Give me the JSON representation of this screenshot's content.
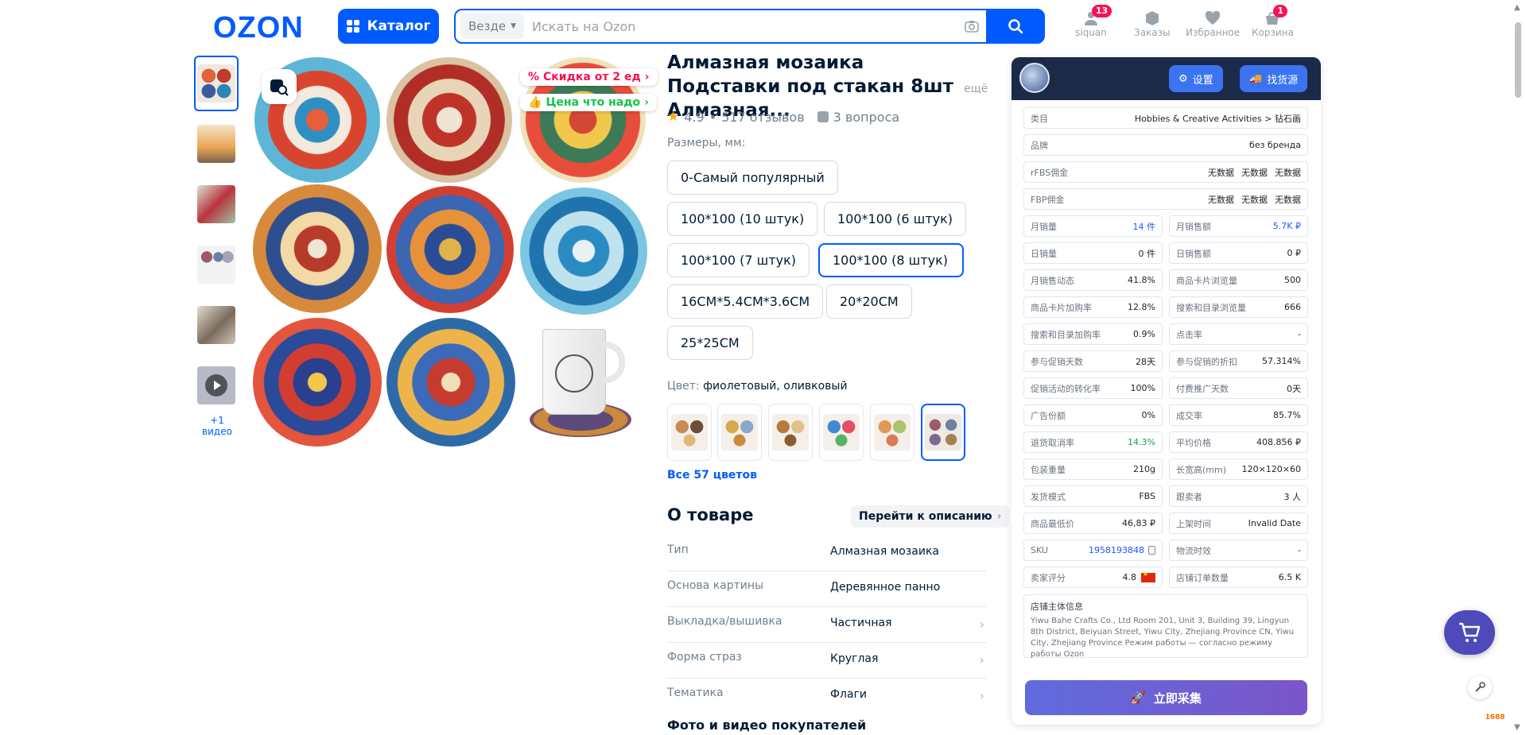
{
  "header": {
    "logo": "OZON",
    "catalog_label": "Каталог",
    "search_scope": "Везде",
    "search_placeholder": "Искать на Ozon",
    "nav": [
      {
        "label": "siquan",
        "badge": "13"
      },
      {
        "label": "Заказы",
        "badge": ""
      },
      {
        "label": "Избранное",
        "badge": ""
      },
      {
        "label": "Корзина",
        "badge": "1"
      }
    ]
  },
  "gallery": {
    "video_label": "+1 видео",
    "stickers": [
      "Скидка от 2 ед",
      "Цена что надо"
    ],
    "colors": {
      "thumb1": "#d84c2f",
      "thumb2": "#e8a552",
      "thumb3": "#c7d3c0",
      "thumb4": "#a8a2b4",
      "thumb5": "#7a6b5c",
      "thumb6": "#9a9fb2"
    }
  },
  "product": {
    "title": "Алмазная мозаика Подставки под стакан 8шт Алмазная...",
    "more": "ещё",
    "rating": "4.9",
    "reviews": "517 отзывов",
    "questions": "3 вопроса",
    "sizes_label": "Размеры, мм:",
    "sizes": [
      "0-Самый популярный",
      "100*100  (10 штук)",
      "100*100  (6 штук)",
      "100*100  (7 штук)",
      "100*100  (8 штук)",
      "16CM*5.4CM*3.6CM",
      "20*20CM",
      "25*25CM"
    ],
    "selected_size": "100*100  (8 штук)",
    "color_label": "Цвет:",
    "color_value": "фиолетовый, оливковый",
    "all_colors": "Все 57 цветов",
    "about_title": "О товаре",
    "to_description": "Перейти к описанию",
    "attributes": [
      {
        "key": "Тип",
        "value": "Алмазная мозаика"
      },
      {
        "key": "Основа картины",
        "value": "Деревянное панно"
      },
      {
        "key": "Выкладка/вышивка",
        "value": "Частичная"
      },
      {
        "key": "Форма страз",
        "value": "Круглая"
      },
      {
        "key": "Тематика",
        "value": "Флаги"
      }
    ],
    "photos_title": "Фото и видео покупателей"
  },
  "panel": {
    "settings_label": "设置",
    "find_source_label": "找货源",
    "category_key": "类目",
    "category_value": "Hobbies & Creative Activities > 钻石画",
    "brand_key": "品牌",
    "brand_value": "без бренда",
    "rfbs_key": "rFBS佣金",
    "fbp_key": "FBP佣金",
    "no_data": "无数据",
    "metrics": [
      {
        "k": "月销量",
        "v": "14 件",
        "tone": "blue"
      },
      {
        "k": "月销售额",
        "v": "5.7K ₽",
        "tone": "blue"
      },
      {
        "k": "日销量",
        "v": "0 件",
        "tone": ""
      },
      {
        "k": "日销售额",
        "v": "0 ₽",
        "tone": ""
      },
      {
        "k": "月销售动态",
        "v": "41.8%",
        "tone": ""
      },
      {
        "k": "商品卡片浏览量",
        "v": "500",
        "tone": ""
      },
      {
        "k": "商品卡片加购率",
        "v": "12.8%",
        "tone": ""
      },
      {
        "k": "搜索和目录浏览量",
        "v": "666",
        "tone": ""
      },
      {
        "k": "搜索和目录加购率",
        "v": "0.9%",
        "tone": ""
      },
      {
        "k": "点击率",
        "v": "-",
        "tone": ""
      },
      {
        "k": "参与促销天数",
        "v": "28天",
        "tone": ""
      },
      {
        "k": "参与促销的折扣",
        "v": "57.314%",
        "tone": ""
      },
      {
        "k": "促销活动的转化率",
        "v": "100%",
        "tone": ""
      },
      {
        "k": "付费推广天数",
        "v": "0天",
        "tone": ""
      },
      {
        "k": "广告份额",
        "v": "0%",
        "tone": ""
      },
      {
        "k": "成交率",
        "v": "85.7%",
        "tone": ""
      },
      {
        "k": "退货取消率",
        "v": "14.3%",
        "tone": "green"
      },
      {
        "k": "平均价格",
        "v": "408.856 ₽",
        "tone": ""
      },
      {
        "k": "包装重量",
        "v": "210g",
        "tone": ""
      },
      {
        "k": "长宽高(mm)",
        "v": "120×120×60",
        "tone": ""
      },
      {
        "k": "发货模式",
        "v": "FBS",
        "tone": ""
      },
      {
        "k": "跟卖者",
        "v": "3 人",
        "tone": ""
      },
      {
        "k": "商品最低价",
        "v": "46,83 ₽",
        "tone": ""
      },
      {
        "k": "上架时间",
        "v": "Invalid Date",
        "tone": ""
      },
      {
        "k": "SKU",
        "v": "1958193848",
        "tone": "blue"
      },
      {
        "k": "物流时效",
        "v": "-",
        "tone": ""
      },
      {
        "k": "卖家评分",
        "v": "4.8",
        "tone": ""
      },
      {
        "k": "店铺订单数量",
        "v": "6.5 K",
        "tone": ""
      }
    ],
    "shop_title": "店铺主体信息",
    "shop_desc": "Yiwu Bahe Crafts Co., Ltd Room 201, Unit 3, Building 39, Lingyun 8th District, Beiyuan Street, Yiwu City, Zhejiang Province CN, Yiwu City, Zhejiang Province Режим работы — согласно режиму работы Ozon",
    "collect_label": "立即采集"
  }
}
